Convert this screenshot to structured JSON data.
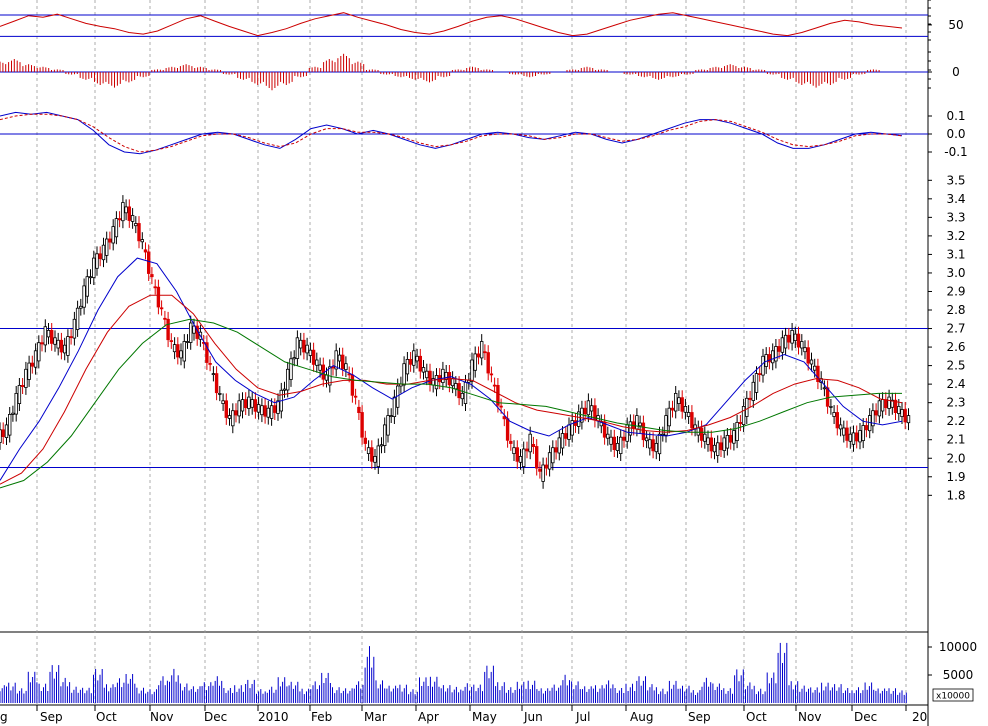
{
  "chart_data": [
    {
      "type": "line",
      "panel": "oscillator",
      "y_ticks": [
        "50"
      ],
      "hlines": [
        63,
        35
      ],
      "series": [
        {
          "color": "#cc0000",
          "values": [
            48,
            55,
            62,
            60,
            64,
            58,
            52,
            48,
            45,
            40,
            38,
            42,
            50,
            58,
            62,
            55,
            48,
            42,
            36,
            40,
            45,
            52,
            58,
            62,
            66,
            60,
            55,
            50,
            44,
            40,
            38,
            42,
            48,
            55,
            60,
            62,
            58,
            52,
            46,
            40,
            36,
            38,
            44,
            50,
            56,
            60,
            64,
            66,
            62,
            58,
            54,
            50,
            46,
            42,
            38,
            36,
            40,
            46,
            52,
            56,
            54,
            50,
            48,
            46
          ]
        }
      ]
    },
    {
      "type": "bar",
      "panel": "histogram",
      "y_ticks": [
        "0"
      ],
      "hlines": [
        0
      ],
      "series": [
        {
          "color": "#cc0000",
          "values": [
            4,
            5,
            3,
            2,
            1,
            -1,
            -3,
            -5,
            -6,
            -4,
            -2,
            1,
            2,
            3,
            2,
            1,
            -1,
            -3,
            -5,
            -7,
            -5,
            -2,
            2,
            5,
            7,
            4,
            1,
            -1,
            -2,
            -3,
            -4,
            -2,
            1,
            2,
            1,
            0,
            -1,
            -2,
            -1,
            0,
            1,
            2,
            1,
            0,
            -1,
            -2,
            -3,
            -2,
            -1,
            1,
            2,
            3,
            2,
            1,
            -1,
            -3,
            -5,
            -6,
            -5,
            -3,
            -1,
            1,
            0,
            0
          ]
        }
      ]
    },
    {
      "type": "line",
      "panel": "macd",
      "y_ticks": [
        "0.1",
        "0.0",
        "-0.1"
      ],
      "hlines": [
        0
      ],
      "ylim": [
        -0.16,
        0.18
      ],
      "series": [
        {
          "color": "#0000cc",
          "style": "solid",
          "values": [
            0.1,
            0.12,
            0.11,
            0.12,
            0.1,
            0.08,
            0.02,
            -0.06,
            -0.1,
            -0.11,
            -0.09,
            -0.06,
            -0.03,
            0.0,
            0.01,
            0.0,
            -0.03,
            -0.06,
            -0.08,
            -0.03,
            0.03,
            0.05,
            0.03,
            0.0,
            0.02,
            0.0,
            -0.03,
            -0.06,
            -0.08,
            -0.06,
            -0.03,
            0.0,
            0.01,
            0.0,
            -0.02,
            -0.03,
            -0.01,
            0.01,
            0.0,
            -0.03,
            -0.05,
            -0.03,
            0.0,
            0.03,
            0.06,
            0.08,
            0.08,
            0.06,
            0.03,
            0.0,
            -0.05,
            -0.08,
            -0.08,
            -0.06,
            -0.03,
            0.0,
            0.01,
            0.0,
            -0.01
          ]
        },
        {
          "color": "#cc0000",
          "style": "dashed",
          "values": [
            0.08,
            0.1,
            0.11,
            0.11,
            0.1,
            0.08,
            0.04,
            -0.02,
            -0.07,
            -0.1,
            -0.09,
            -0.07,
            -0.04,
            -0.01,
            0.0,
            0.0,
            -0.02,
            -0.05,
            -0.07,
            -0.05,
            0.0,
            0.03,
            0.03,
            0.01,
            0.01,
            0.0,
            -0.02,
            -0.05,
            -0.07,
            -0.06,
            -0.04,
            -0.01,
            0.0,
            0.0,
            -0.01,
            -0.03,
            -0.02,
            0.0,
            0.0,
            -0.02,
            -0.04,
            -0.03,
            -0.01,
            0.02,
            0.04,
            0.07,
            0.08,
            0.07,
            0.04,
            0.01,
            -0.03,
            -0.06,
            -0.07,
            -0.06,
            -0.04,
            -0.01,
            0.0,
            0.0,
            -0.01
          ]
        }
      ]
    },
    {
      "type": "candlestick",
      "panel": "price",
      "y_ticks": [
        "3.5",
        "3.4",
        "3.3",
        "3.2",
        "3.1",
        "3.0",
        "2.9",
        "2.8",
        "2.7",
        "2.6",
        "2.5",
        "2.4",
        "2.3",
        "2.2",
        "2.1",
        "2.0",
        "1.9",
        "1.8"
      ],
      "ylim": [
        1.72,
        3.52
      ],
      "hlines": [
        2.7,
        1.95
      ],
      "x_labels": [
        "g",
        "Sep",
        "Oct",
        "Nov",
        "Dec",
        "2010",
        "Feb",
        "Mar",
        "Apr",
        "May",
        "Jun",
        "Jul",
        "Aug",
        "Sep",
        "Oct",
        "Nov",
        "Dec",
        "20"
      ],
      "up_color": "#000000",
      "down_color": "#dd0000",
      "close": [
        2.15,
        2.32,
        2.45,
        2.55,
        2.68,
        2.62,
        2.58,
        2.72,
        2.9,
        3.05,
        3.12,
        3.22,
        3.35,
        3.28,
        3.15,
        2.95,
        2.78,
        2.6,
        2.55,
        2.7,
        2.65,
        2.48,
        2.32,
        2.2,
        2.28,
        2.3,
        2.26,
        2.24,
        2.28,
        2.45,
        2.62,
        2.58,
        2.5,
        2.42,
        2.55,
        2.48,
        2.3,
        2.05,
        1.98,
        2.15,
        2.3,
        2.48,
        2.55,
        2.46,
        2.4,
        2.45,
        2.4,
        2.32,
        2.5,
        2.6,
        2.42,
        2.25,
        2.05,
        1.98,
        2.1,
        1.9,
        2.0,
        2.08,
        2.15,
        2.22,
        2.28,
        2.2,
        2.1,
        2.05,
        2.15,
        2.2,
        2.08,
        2.05,
        2.2,
        2.32,
        2.25,
        2.15,
        2.1,
        2.04,
        2.08,
        2.12,
        2.25,
        2.38,
        2.52,
        2.55,
        2.62,
        2.66,
        2.6,
        2.5,
        2.4,
        2.25,
        2.15,
        2.1,
        2.12,
        2.2,
        2.28,
        2.3,
        2.25,
        2.2
      ],
      "overlays": [
        {
          "color": "#0000cc",
          "values": [
            1.88,
            2.05,
            2.2,
            2.38,
            2.58,
            2.8,
            2.98,
            3.08,
            3.05,
            2.9,
            2.7,
            2.52,
            2.42,
            2.35,
            2.3,
            2.33,
            2.42,
            2.5,
            2.45,
            2.38,
            2.32,
            2.38,
            2.42,
            2.44,
            2.4,
            2.32,
            2.2,
            2.15,
            2.12,
            2.18,
            2.22,
            2.18,
            2.14,
            2.13,
            2.12,
            2.14,
            2.18,
            2.3,
            2.42,
            2.52,
            2.56,
            2.52,
            2.4,
            2.28,
            2.2,
            2.18,
            2.2
          ]
        },
        {
          "color": "#cc0000",
          "values": [
            1.86,
            1.92,
            2.05,
            2.25,
            2.48,
            2.68,
            2.82,
            2.88,
            2.88,
            2.78,
            2.62,
            2.48,
            2.38,
            2.34,
            2.36,
            2.4,
            2.42,
            2.42,
            2.4,
            2.4,
            2.42,
            2.43,
            2.42,
            2.36,
            2.3,
            2.26,
            2.24,
            2.22,
            2.2,
            2.17,
            2.15,
            2.14,
            2.15,
            2.18,
            2.22,
            2.28,
            2.35,
            2.4,
            2.43,
            2.42,
            2.38,
            2.32,
            2.3
          ]
        },
        {
          "color": "#007700",
          "values": [
            1.84,
            1.88,
            1.98,
            2.12,
            2.3,
            2.48,
            2.62,
            2.72,
            2.75,
            2.73,
            2.68,
            2.6,
            2.52,
            2.48,
            2.44,
            2.42,
            2.41,
            2.4,
            2.4,
            2.38,
            2.34,
            2.3,
            2.29,
            2.28,
            2.25,
            2.22,
            2.19,
            2.17,
            2.15,
            2.14,
            2.14,
            2.16,
            2.2,
            2.25,
            2.3,
            2.33,
            2.34,
            2.35,
            2.35
          ]
        }
      ]
    },
    {
      "type": "bar",
      "panel": "volume",
      "y_ticks": [
        "10000",
        "5000"
      ],
      "scale_label": "x10000",
      "color": "#0000cc",
      "values": [
        3200,
        4100,
        2800,
        5600,
        3900,
        7200,
        4500,
        3300,
        2900,
        6100,
        3800,
        4700,
        5200,
        3100,
        2600,
        4800,
        6900,
        3700,
        3000,
        4200,
        5100,
        2700,
        3600,
        4400,
        2500,
        3300,
        4900,
        3800,
        2900,
        4100,
        5400,
        3200,
        2800,
        3900,
        11500,
        4300,
        3100,
        3700,
        2600,
        4600,
        5300,
        3400,
        2900,
        4000,
        3500,
        6700,
        4200,
        3000,
        3800,
        4500,
        2800,
        3300,
        5700,
        4100,
        3000,
        3600,
        4300,
        2700,
        3900,
        5100,
        3400,
        2900,
        4200,
        3100,
        2600,
        4800,
        3500,
        3000,
        6400,
        3700,
        2900,
        5800,
        10800,
        4400,
        3300,
        2800,
        4100,
        3600,
        2700,
        3200,
        3900,
        2600,
        3000,
        2400
      ]
    }
  ]
}
